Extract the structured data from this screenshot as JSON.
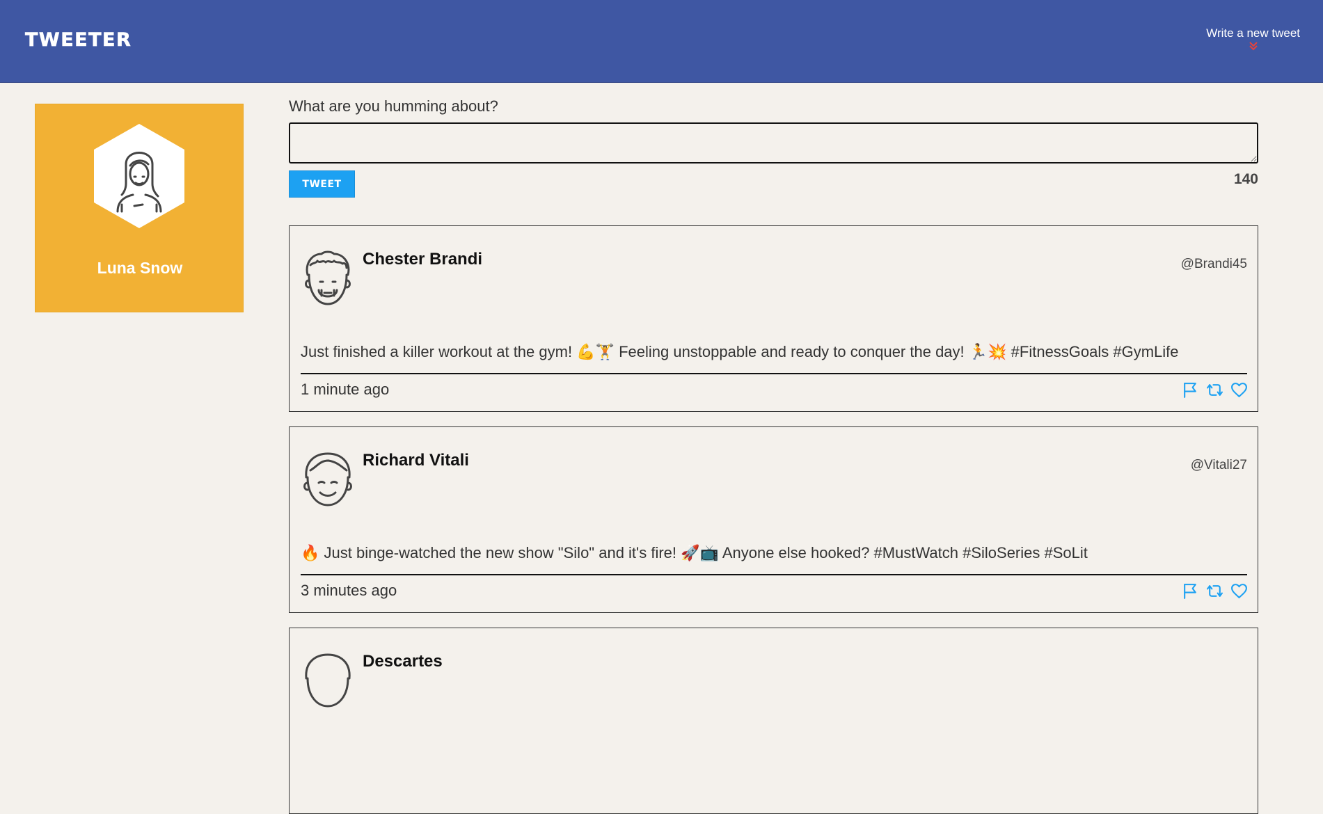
{
  "nav": {
    "brand": "TWEETER",
    "write_label": "Write a new tweet",
    "chevron_icon": "double-chevron-down-icon",
    "chevron_color": "#e8433b"
  },
  "profile": {
    "name": "Luna Snow",
    "avatar_icon": "woman-avatar-icon",
    "background_color": "#f2b134"
  },
  "compose": {
    "label": "What are you humming about?",
    "value": "",
    "button_label": "TWEET",
    "counter": "140"
  },
  "tweets": [
    {
      "name": "Chester Brandi",
      "handle": "@Brandi45",
      "avatar_icon": "curly-haired-man-avatar-icon",
      "text": "Just finished a killer workout at the gym! 💪🏋️ Feeling unstoppable and ready to conquer the day! 🏃💥 #FitnessGoals #GymLife",
      "time": "1 minute ago"
    },
    {
      "name": "Richard Vitali",
      "handle": "@Vitali27",
      "avatar_icon": "smiling-man-avatar-icon",
      "text": "🔥 Just binge-watched the new show \"Silo\" and it's fire! 🚀📺 Anyone else hooked? #MustWatch #SiloSeries #SoLit",
      "time": "3 minutes ago"
    },
    {
      "name": "Descartes",
      "handle": "",
      "avatar_icon": "man-avatar-icon",
      "text": "",
      "time": ""
    }
  ],
  "action_icons": [
    "flag-icon",
    "retweet-icon",
    "heart-icon"
  ],
  "accent_color": "#1da1f2",
  "nav_color": "#3f57a3"
}
